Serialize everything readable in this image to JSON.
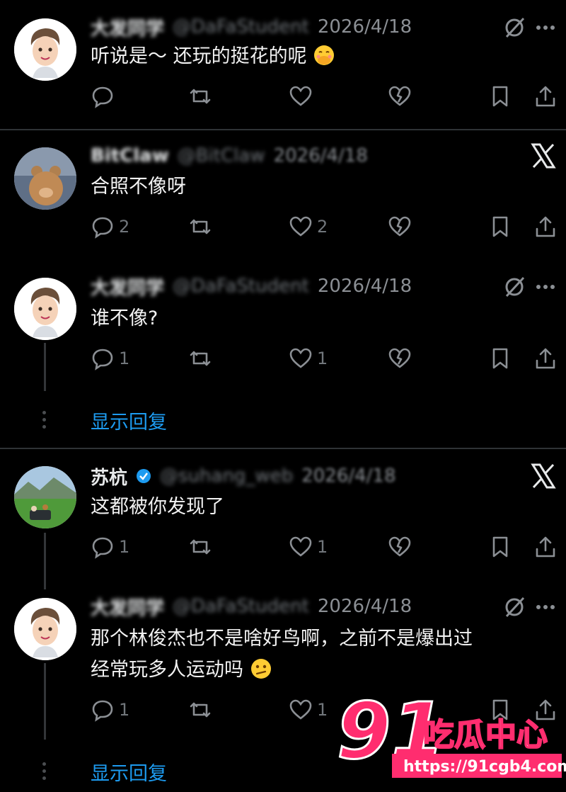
{
  "tweets": [
    {
      "name": "大发同学",
      "handle": "@DaFaStudent",
      "date": "2026/4/18",
      "text": "听说是～ 还玩的挺花的呢",
      "emoji": "face-with-hand-over-mouth",
      "replies": "",
      "likes": ""
    },
    {
      "name": "BitClaw",
      "handle": "@BitClaw",
      "date": "2026/4/18",
      "text": "合照不像呀",
      "replies": "2",
      "likes": "2"
    },
    {
      "name": "大发同学",
      "handle": "@DaFaStudent",
      "date": "2026/4/18",
      "text": "谁不像?",
      "replies": "1",
      "likes": "1"
    },
    {
      "name": "苏杭",
      "handle": "@suhang_web",
      "date": "2026/4/18",
      "text": "这都被你发现了",
      "replies": "1",
      "likes": "1"
    },
    {
      "name": "大发同学",
      "handle": "@DaFaStudent",
      "date": "2026/4/18",
      "text_line1": "那个林俊杰也不是啥好鸟啊，之前不是爆出过",
      "text_line2": "经常玩多人运动吗",
      "emoji": "confused-face",
      "replies": "1",
      "likes": "1"
    }
  ],
  "show_replies_label": "显示回复",
  "watermark": {
    "number": "91",
    "brand": "吃瓜中心",
    "url": "https://91cgb4.com"
  },
  "colors": {
    "background": "#000000",
    "text": "#e7e9ea",
    "muted": "#71767b",
    "link": "#1d9bf0",
    "watermark_pink": "#ff2d6f"
  }
}
